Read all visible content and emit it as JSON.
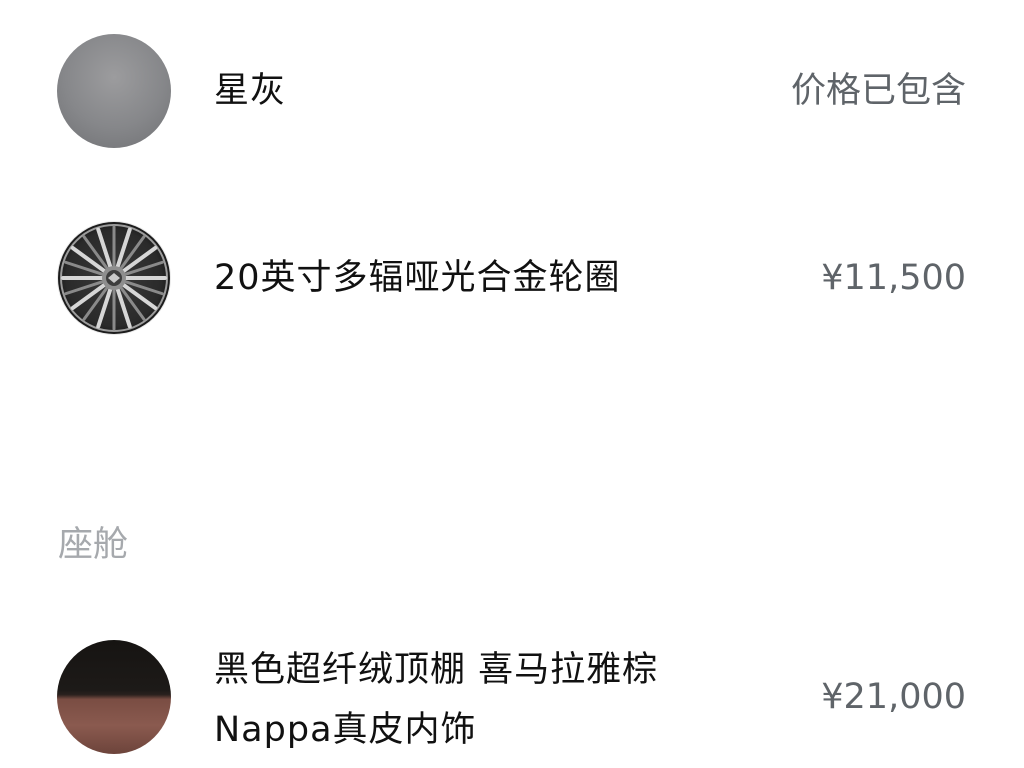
{
  "options": [
    {
      "name": "星灰",
      "price": "价格已包含",
      "swatch_color": "#88898c"
    },
    {
      "name": "20英寸多辐哑光合金轮圈",
      "price": "¥11,500"
    }
  ],
  "cabin_section": {
    "title": "座舱",
    "items": [
      {
        "name_line1": "黑色超纤绒顶棚 喜马拉雅棕",
        "name_line2": "Nappa真皮内饰",
        "price": "¥21,000",
        "swatch_top_color": "#1a1816",
        "swatch_bottom_color": "#835448"
      }
    ]
  }
}
